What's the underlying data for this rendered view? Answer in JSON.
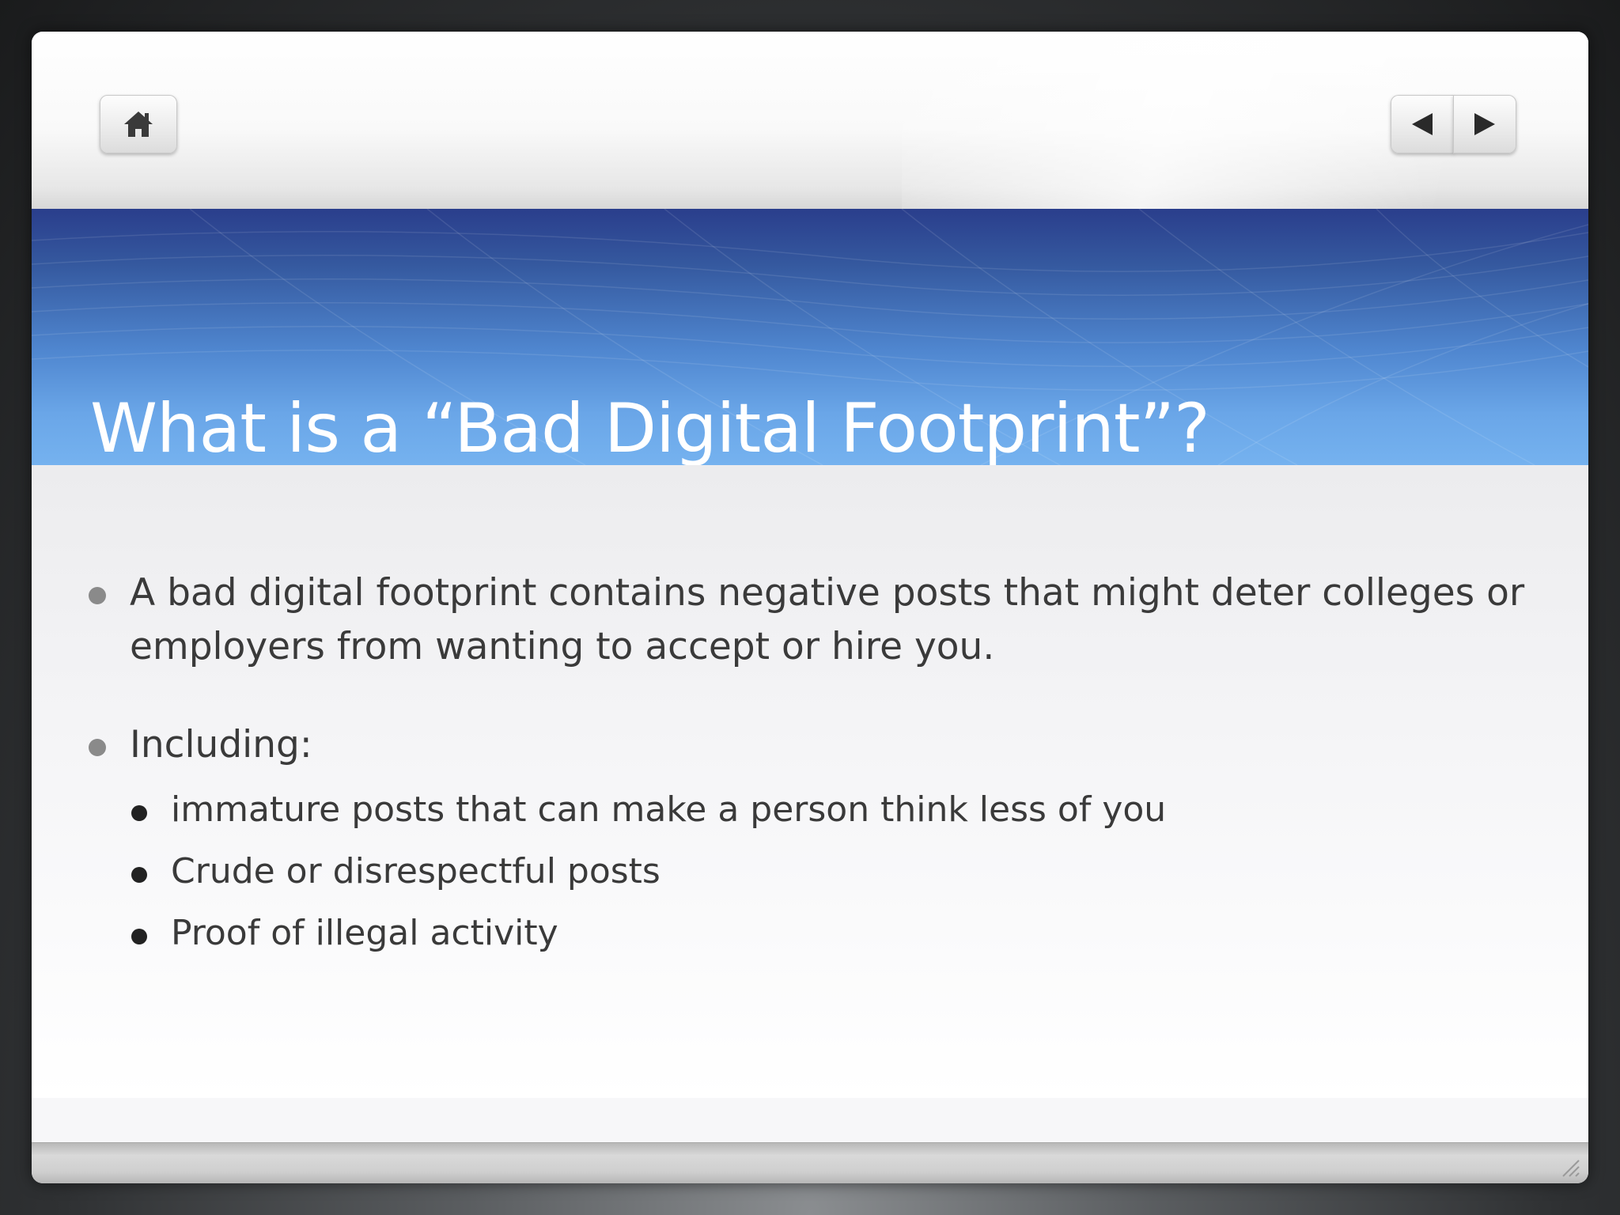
{
  "slide": {
    "title": "What is a “Bad Digital Footprint”?",
    "bullets": [
      {
        "text": "A bad digital footprint contains negative posts that might deter colleges or employers from wanting to accept or hire you."
      },
      {
        "text": "Including:",
        "sub_bullets": [
          "immature posts that can make a person think less of you",
          "Crude or disrespectful posts",
          "Proof of illegal activity"
        ]
      }
    ]
  },
  "navigation": {
    "home_icon": "home-icon",
    "prev_icon": "triangle-left-icon",
    "next_icon": "triangle-right-icon"
  },
  "colors": {
    "title_band_top": "#2a3e8c",
    "title_band_bottom": "#75b2ef",
    "title_text": "#ffffff",
    "body_text": "#3a3a3a"
  }
}
